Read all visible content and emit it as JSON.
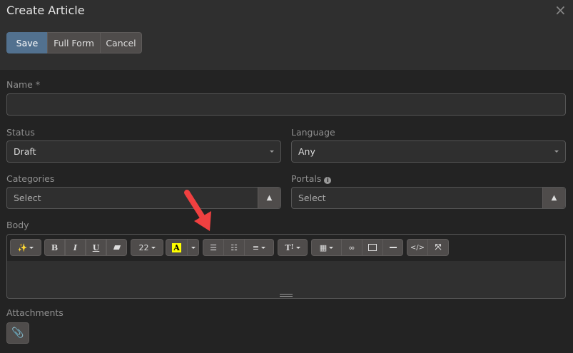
{
  "dialog": {
    "title": "Create Article",
    "close_icon": "close-icon"
  },
  "actions": {
    "save": "Save",
    "full_form": "Full Form",
    "cancel": "Cancel"
  },
  "form": {
    "name": {
      "label": "Name *",
      "value": ""
    },
    "status": {
      "label": "Status",
      "value": "Draft"
    },
    "language": {
      "label": "Language",
      "value": "Any"
    },
    "categories": {
      "label": "Categories",
      "placeholder": "Select"
    },
    "portals": {
      "label": "Portals",
      "placeholder": "Select"
    },
    "body": {
      "label": "Body",
      "font_size": "22",
      "text_color_letter": "A",
      "highlight_color": "#ffff00"
    },
    "attachments": {
      "label": "Attachments"
    }
  },
  "colors": {
    "accent": "#52718f",
    "annotation_arrow": "#f04040"
  }
}
